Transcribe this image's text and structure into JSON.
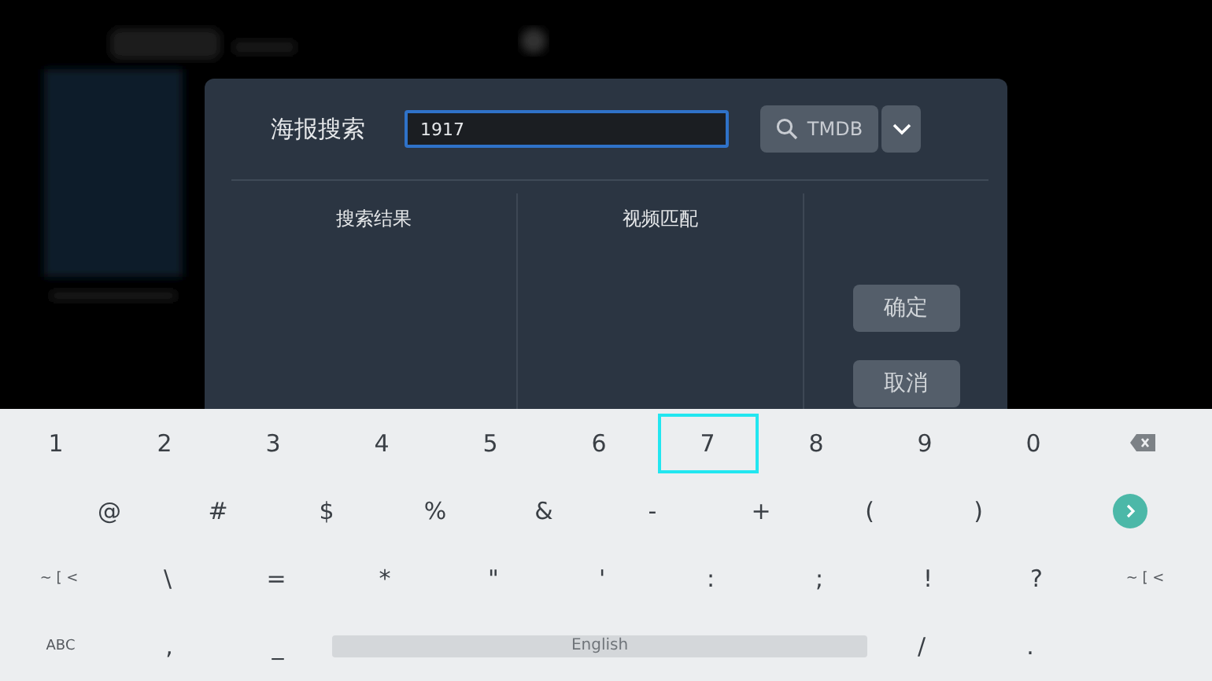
{
  "dialog": {
    "title": "海报搜索",
    "query": {
      "value": "1917",
      "focused": true
    },
    "search_button": {
      "label": "TMDB"
    },
    "columns": [
      {
        "heading": "搜索结果"
      },
      {
        "heading": "视频匹配"
      }
    ],
    "buttons": [
      {
        "label": "确定"
      },
      {
        "label": "取消"
      }
    ]
  },
  "keyboard": {
    "rows": [
      {
        "keys": [
          {
            "label": "1",
            "kind": "char",
            "selected": false
          },
          {
            "label": "2",
            "kind": "char",
            "selected": false
          },
          {
            "label": "3",
            "kind": "char",
            "selected": false
          },
          {
            "label": "4",
            "kind": "char",
            "selected": false
          },
          {
            "label": "5",
            "kind": "char",
            "selected": false
          },
          {
            "label": "6",
            "kind": "char",
            "selected": false
          },
          {
            "label": "7",
            "kind": "char",
            "selected": true
          },
          {
            "label": "8",
            "kind": "char",
            "selected": false
          },
          {
            "label": "9",
            "kind": "char",
            "selected": false
          },
          {
            "label": "0",
            "kind": "char",
            "selected": false
          },
          {
            "kind": "backspace",
            "selected": false
          }
        ]
      },
      {
        "keys": [
          {
            "label": "@",
            "kind": "char",
            "selected": false
          },
          {
            "label": "#",
            "kind": "char",
            "selected": false
          },
          {
            "label": "$",
            "kind": "char",
            "selected": false
          },
          {
            "label": "%",
            "kind": "char",
            "selected": false
          },
          {
            "label": "&",
            "kind": "char",
            "selected": false
          },
          {
            "label": "-",
            "kind": "char",
            "selected": false
          },
          {
            "label": "+",
            "kind": "char",
            "selected": false
          },
          {
            "label": "(",
            "kind": "char",
            "selected": false
          },
          {
            "label": ")",
            "kind": "char",
            "selected": false
          },
          {
            "kind": "enter",
            "selected": false
          }
        ]
      },
      {
        "keys": [
          {
            "label": "~ [ <",
            "kind": "mode",
            "selected": false
          },
          {
            "label": "\\",
            "kind": "char",
            "selected": false
          },
          {
            "label": "=",
            "kind": "char",
            "selected": false
          },
          {
            "label": "*",
            "kind": "char",
            "selected": false
          },
          {
            "label": "\"",
            "kind": "char",
            "selected": false
          },
          {
            "label": "'",
            "kind": "char",
            "selected": false
          },
          {
            "label": ":",
            "kind": "char",
            "selected": false
          },
          {
            "label": ";",
            "kind": "char",
            "selected": false
          },
          {
            "label": "!",
            "kind": "char",
            "selected": false
          },
          {
            "label": "?",
            "kind": "char",
            "selected": false
          },
          {
            "label": "~ [ <",
            "kind": "mode",
            "selected": false
          }
        ]
      },
      {
        "keys": [
          {
            "label": "ABC",
            "kind": "mode",
            "selected": false
          },
          {
            "label": ",",
            "kind": "char",
            "selected": false
          },
          {
            "label": "_",
            "kind": "char",
            "selected": false
          },
          {
            "label": "English",
            "kind": "space",
            "selected": false
          },
          {
            "label": "/",
            "kind": "char",
            "selected": false
          },
          {
            "label": ".",
            "kind": "char",
            "selected": false
          }
        ]
      }
    ]
  }
}
